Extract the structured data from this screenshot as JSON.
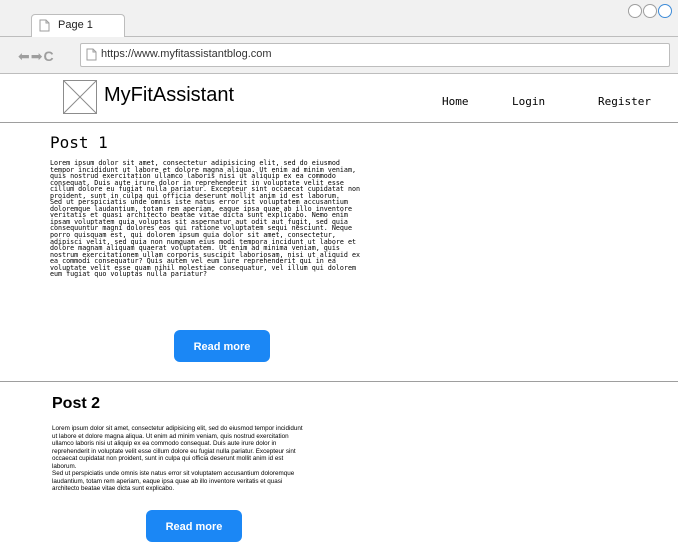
{
  "browser": {
    "tab_label": "Page 1",
    "url": "https://www.myfitassistantblog.com"
  },
  "header": {
    "site_title": "MyFitAssistant",
    "nav": {
      "home": "Home",
      "login": "Login",
      "register": "Register"
    }
  },
  "posts": [
    {
      "title": "Post 1",
      "body": "Lorem ipsum dolor sit amet, consectetur adipisicing elit, sed do eiusmod\ntempor incididunt ut labore et dolore magna aliqua. Ut enim ad minim veniam,\nquis nostrud exercitation ullamco laboris nisi ut aliquip ex ea commodo\nconsequat. Duis aute irure dolor in reprehenderit in voluptate velit esse\ncillum dolore eu fugiat nulla pariatur. Excepteur sint occaecat cupidatat non\nproident, sunt in culpa qui officia deserunt mollit anim id est laborum.\nSed ut perspiciatis unde omnis iste natus error sit voluptatem accusantium\ndoloremque laudantium, totam rem aperiam, eaque ipsa quae ab illo inventore\nveritatis et quasi architecto beatae vitae dicta sunt explicabo. Nemo enim\nipsam voluptatem quia voluptas sit aspernatur aut odit aut fugit, sed quia\nconsequuntur magni dolores eos qui ratione voluptatem sequi nesciunt. Neque\nporro quisquam est, qui dolorem ipsum quia dolor sit amet, consectetur,\nadipisci velit, sed quia non numquam eius modi tempora incidunt ut labore et\ndolore magnam aliquam quaerat voluptatem. Ut enim ad minima veniam, quis\nnostrum exercitationem ullam corporis suscipit laboriosam, nisi ut aliquid ex\nea commodi consequatur? Quis autem vel eum iure reprehenderit qui in ea\nvoluptate velit esse quam nihil molestiae consequatur, vel illum qui dolorem\neum fugiat quo voluptas nulla pariatur?",
      "read_more": "Read more"
    },
    {
      "title": "Post 2",
      "body": "Lorem ipsum dolor sit amet, consectetur adipisicing elit, sed do eiusmod tempor incididunt\nut labore et dolore magna aliqua. Ut enim ad minim veniam, quis nostrud exercitation\nullamco laboris nisi ut aliquip ex ea commodo consequat. Duis aute irure dolor in\nreprehenderit in voluptate velit esse cillum dolore eu fugiat nulla pariatur. Excepteur sint\noccaecat cupidatat non proident, sunt in culpa qui officia deserunt mollit anim id est\nlaborum.\nSed ut perspiciatis unde omnis iste natus error sit voluptatem accusantium doloremque\nlaudantium, totam rem aperiam, eaque ipsa quae ab illo inventore veritatis et quasi\narchitecto beatae vitae dicta sunt explicabo.",
      "read_more": "Read more"
    }
  ],
  "icons": {
    "page": "page-icon",
    "back": "back-arrow-icon",
    "forward": "forward-arrow-icon",
    "reload": "reload-icon",
    "logo": "image-placeholder-icon"
  },
  "colors": {
    "accent": "#1b87f5",
    "chrome": "#f1f1f1",
    "border": "#bdbdbd"
  }
}
